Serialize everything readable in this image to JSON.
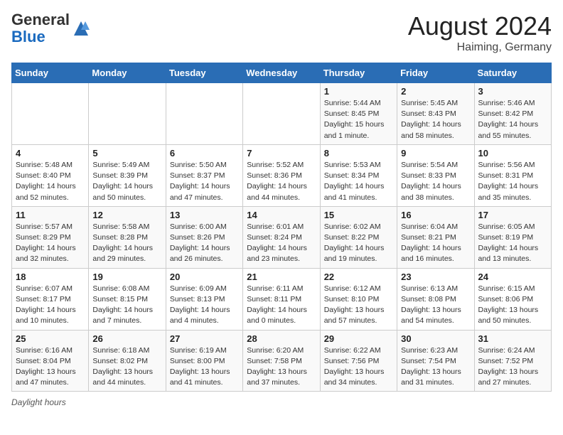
{
  "header": {
    "logo_general": "General",
    "logo_blue": "Blue",
    "month_year": "August 2024",
    "location": "Haiming, Germany"
  },
  "footer": {
    "note": "Daylight hours"
  },
  "weekdays": [
    "Sunday",
    "Monday",
    "Tuesday",
    "Wednesday",
    "Thursday",
    "Friday",
    "Saturday"
  ],
  "weeks": [
    [
      {
        "day": "",
        "info": ""
      },
      {
        "day": "",
        "info": ""
      },
      {
        "day": "",
        "info": ""
      },
      {
        "day": "",
        "info": ""
      },
      {
        "day": "1",
        "info": "Sunrise: 5:44 AM\nSunset: 8:45 PM\nDaylight: 15 hours\nand 1 minute."
      },
      {
        "day": "2",
        "info": "Sunrise: 5:45 AM\nSunset: 8:43 PM\nDaylight: 14 hours\nand 58 minutes."
      },
      {
        "day": "3",
        "info": "Sunrise: 5:46 AM\nSunset: 8:42 PM\nDaylight: 14 hours\nand 55 minutes."
      }
    ],
    [
      {
        "day": "4",
        "info": "Sunrise: 5:48 AM\nSunset: 8:40 PM\nDaylight: 14 hours\nand 52 minutes."
      },
      {
        "day": "5",
        "info": "Sunrise: 5:49 AM\nSunset: 8:39 PM\nDaylight: 14 hours\nand 50 minutes."
      },
      {
        "day": "6",
        "info": "Sunrise: 5:50 AM\nSunset: 8:37 PM\nDaylight: 14 hours\nand 47 minutes."
      },
      {
        "day": "7",
        "info": "Sunrise: 5:52 AM\nSunset: 8:36 PM\nDaylight: 14 hours\nand 44 minutes."
      },
      {
        "day": "8",
        "info": "Sunrise: 5:53 AM\nSunset: 8:34 PM\nDaylight: 14 hours\nand 41 minutes."
      },
      {
        "day": "9",
        "info": "Sunrise: 5:54 AM\nSunset: 8:33 PM\nDaylight: 14 hours\nand 38 minutes."
      },
      {
        "day": "10",
        "info": "Sunrise: 5:56 AM\nSunset: 8:31 PM\nDaylight: 14 hours\nand 35 minutes."
      }
    ],
    [
      {
        "day": "11",
        "info": "Sunrise: 5:57 AM\nSunset: 8:29 PM\nDaylight: 14 hours\nand 32 minutes."
      },
      {
        "day": "12",
        "info": "Sunrise: 5:58 AM\nSunset: 8:28 PM\nDaylight: 14 hours\nand 29 minutes."
      },
      {
        "day": "13",
        "info": "Sunrise: 6:00 AM\nSunset: 8:26 PM\nDaylight: 14 hours\nand 26 minutes."
      },
      {
        "day": "14",
        "info": "Sunrise: 6:01 AM\nSunset: 8:24 PM\nDaylight: 14 hours\nand 23 minutes."
      },
      {
        "day": "15",
        "info": "Sunrise: 6:02 AM\nSunset: 8:22 PM\nDaylight: 14 hours\nand 19 minutes."
      },
      {
        "day": "16",
        "info": "Sunrise: 6:04 AM\nSunset: 8:21 PM\nDaylight: 14 hours\nand 16 minutes."
      },
      {
        "day": "17",
        "info": "Sunrise: 6:05 AM\nSunset: 8:19 PM\nDaylight: 14 hours\nand 13 minutes."
      }
    ],
    [
      {
        "day": "18",
        "info": "Sunrise: 6:07 AM\nSunset: 8:17 PM\nDaylight: 14 hours\nand 10 minutes."
      },
      {
        "day": "19",
        "info": "Sunrise: 6:08 AM\nSunset: 8:15 PM\nDaylight: 14 hours\nand 7 minutes."
      },
      {
        "day": "20",
        "info": "Sunrise: 6:09 AM\nSunset: 8:13 PM\nDaylight: 14 hours\nand 4 minutes."
      },
      {
        "day": "21",
        "info": "Sunrise: 6:11 AM\nSunset: 8:11 PM\nDaylight: 14 hours\nand 0 minutes."
      },
      {
        "day": "22",
        "info": "Sunrise: 6:12 AM\nSunset: 8:10 PM\nDaylight: 13 hours\nand 57 minutes."
      },
      {
        "day": "23",
        "info": "Sunrise: 6:13 AM\nSunset: 8:08 PM\nDaylight: 13 hours\nand 54 minutes."
      },
      {
        "day": "24",
        "info": "Sunrise: 6:15 AM\nSunset: 8:06 PM\nDaylight: 13 hours\nand 50 minutes."
      }
    ],
    [
      {
        "day": "25",
        "info": "Sunrise: 6:16 AM\nSunset: 8:04 PM\nDaylight: 13 hours\nand 47 minutes."
      },
      {
        "day": "26",
        "info": "Sunrise: 6:18 AM\nSunset: 8:02 PM\nDaylight: 13 hours\nand 44 minutes."
      },
      {
        "day": "27",
        "info": "Sunrise: 6:19 AM\nSunset: 8:00 PM\nDaylight: 13 hours\nand 41 minutes."
      },
      {
        "day": "28",
        "info": "Sunrise: 6:20 AM\nSunset: 7:58 PM\nDaylight: 13 hours\nand 37 minutes."
      },
      {
        "day": "29",
        "info": "Sunrise: 6:22 AM\nSunset: 7:56 PM\nDaylight: 13 hours\nand 34 minutes."
      },
      {
        "day": "30",
        "info": "Sunrise: 6:23 AM\nSunset: 7:54 PM\nDaylight: 13 hours\nand 31 minutes."
      },
      {
        "day": "31",
        "info": "Sunrise: 6:24 AM\nSunset: 7:52 PM\nDaylight: 13 hours\nand 27 minutes."
      }
    ]
  ]
}
